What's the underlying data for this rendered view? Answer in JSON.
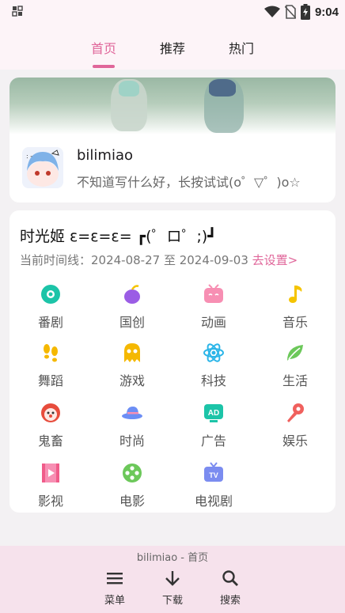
{
  "status_bar": {
    "time": "9:04",
    "icons": [
      "notification-grid-icon",
      "wifi-icon",
      "no-sim-icon",
      "battery-charging-icon"
    ]
  },
  "tabs": [
    {
      "label": "首页",
      "active": true
    },
    {
      "label": "推荐",
      "active": false
    },
    {
      "label": "热门",
      "active": false
    }
  ],
  "user_card": {
    "username": "bilimiao",
    "signature": "不知道写什么好，长按试试(o゜▽゜)o☆"
  },
  "timeline_card": {
    "title": "时光姬  ε=ε=ε= ┏(゜ロ゜;)┛",
    "range_label": "当前时间线：2024-08-27 至 2024-09-03",
    "settings_link": "去设置>",
    "categories": [
      {
        "label": "番剧",
        "icon": "bangumi-icon",
        "color": "#1cc4a8"
      },
      {
        "label": "国创",
        "icon": "guochuang-icon",
        "color": "#9b5de5"
      },
      {
        "label": "动画",
        "icon": "animation-tv-icon",
        "color": "#f78fb3"
      },
      {
        "label": "音乐",
        "icon": "music-note-icon",
        "color": "#f5c400"
      },
      {
        "label": "舞蹈",
        "icon": "footprints-icon",
        "color": "#f5b800"
      },
      {
        "label": "游戏",
        "icon": "ghost-icon",
        "color": "#f5b800"
      },
      {
        "label": "科技",
        "icon": "atom-icon",
        "color": "#2bb5e8"
      },
      {
        "label": "生活",
        "icon": "leaf-icon",
        "color": "#6cc85a"
      },
      {
        "label": "鬼畜",
        "icon": "clown-icon",
        "color": "#e74c3c"
      },
      {
        "label": "时尚",
        "icon": "hat-icon",
        "color": "#6c8ef5"
      },
      {
        "label": "广告",
        "icon": "ad-tv-icon",
        "color": "#1cc4a8"
      },
      {
        "label": "娱乐",
        "icon": "microphone-icon",
        "color": "#f0605d"
      },
      {
        "label": "影视",
        "icon": "film-play-icon",
        "color": "#f78fb3"
      },
      {
        "label": "电影",
        "icon": "film-reel-icon",
        "color": "#6cc85a"
      },
      {
        "label": "电视剧",
        "icon": "tv-icon",
        "color": "#7b8cf0"
      }
    ]
  },
  "bottom_bar": {
    "page_label": "bilimiao - 首页",
    "nav": [
      {
        "label": "菜单",
        "icon": "menu-icon"
      },
      {
        "label": "下载",
        "icon": "download-arrow-icon"
      },
      {
        "label": "搜索",
        "icon": "search-icon"
      }
    ]
  },
  "colors": {
    "accent": "#e0669a",
    "tab_bg": "#fdf4f8",
    "bottom_bg": "#f6e2ec"
  }
}
